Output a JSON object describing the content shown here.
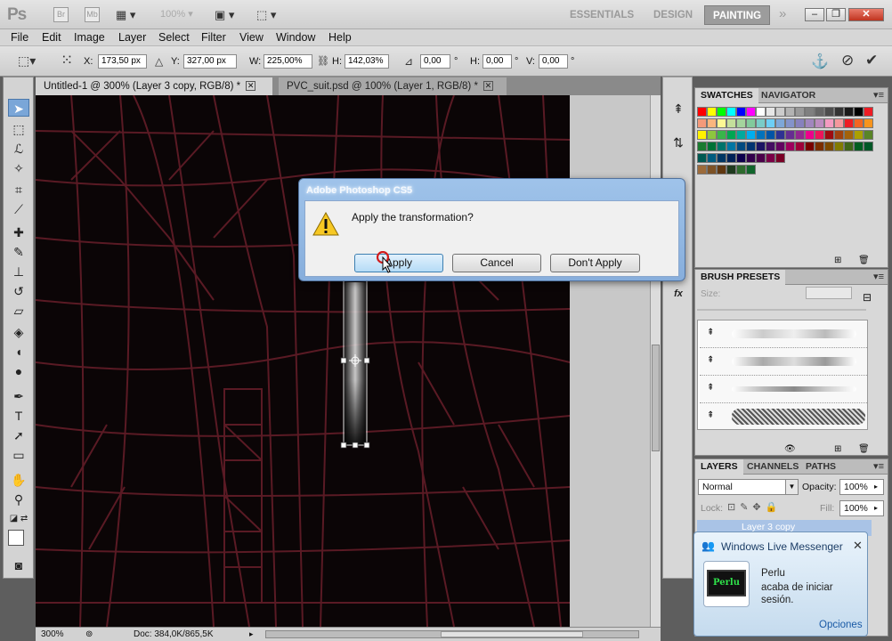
{
  "app": {
    "logo": "Ps",
    "mini_br": "Br",
    "mini_mb": "Mb",
    "zoom": "100%"
  },
  "workspaces": [
    "ESSENTIALS",
    "DESIGN",
    "PAINTING"
  ],
  "menu": [
    "File",
    "Edit",
    "Image",
    "Layer",
    "Select",
    "Filter",
    "View",
    "Window",
    "Help"
  ],
  "options": {
    "x_label": "X:",
    "x_value": "173,50 px",
    "y_label": "Y:",
    "y_value": "327,00 px",
    "w_label": "W:",
    "w_value": "225,00%",
    "h_label": "H:",
    "h_value": "142,03%",
    "angle_value": "0,00",
    "degree": "°",
    "hskew_label": "H:",
    "hskew_value": "0,00",
    "vskew_label": "V:",
    "vskew_value": "0,00"
  },
  "tabs": [
    {
      "label": "Untitled-1 @ 300% (Layer 3 copy, RGB/8) *"
    },
    {
      "label": "PVC_suit.psd @ 100% (Layer 1, RGB/8) *"
    }
  ],
  "status": {
    "zoom": "300%",
    "doc": "Doc: 384,0K/865,5K"
  },
  "panels": {
    "swatches_tab": "SWATCHES",
    "navigator_tab": "NAVIGATOR",
    "brush_presets_tab": "BRUSH PRESETS",
    "size_label": "Size:",
    "layers_tab": "LAYERS",
    "channels_tab": "CHANNELS",
    "paths_tab": "PATHS",
    "blend_mode": "Normal",
    "opacity_label": "Opacity:",
    "opacity_value": "100%",
    "lock_label": "Lock:",
    "fill_label": "Fill:",
    "fill_value": "100%",
    "layer_name": "Layer 3 copy"
  },
  "dialog": {
    "title": "Adobe Photoshop CS5",
    "message": "Apply the transformation?",
    "apply": "Apply",
    "cancel": "Cancel",
    "dont_apply": "Don't Apply"
  },
  "messenger": {
    "title": "Windows Live Messenger",
    "user": "Perlu",
    "line1": "acaba de iniciar",
    "line2": "sesión.",
    "options": "Opciones",
    "avatar_text": "Perlu"
  },
  "colors": {
    "accent": "#7aa6d8",
    "mesh": "#5a1a24",
    "canvas": "#0b0506"
  }
}
